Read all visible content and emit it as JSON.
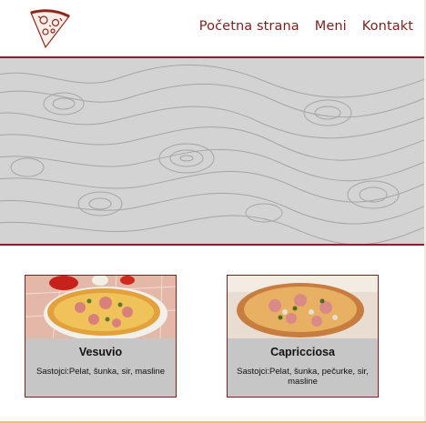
{
  "header": {
    "logo_icon": "pizza-slice-icon",
    "nav": [
      "Početna strana",
      "Meni",
      "Kontakt"
    ]
  },
  "hero": {
    "pattern": "topographic-contour-lines"
  },
  "menu": {
    "items": [
      {
        "name": "Vesuvio",
        "ingredients": "Sastojci:Pelat, šunka, sir, masline"
      },
      {
        "name": "Capricciosa",
        "ingredients": "Sastojci:Pelat, šunka, pečurke, sir, masline"
      }
    ]
  },
  "colors": {
    "accent": "#7b1f1f",
    "hero_border": "#8b1e2a",
    "card_bg": "#c6c6c6",
    "hero_bg": "#d2d2d2"
  }
}
